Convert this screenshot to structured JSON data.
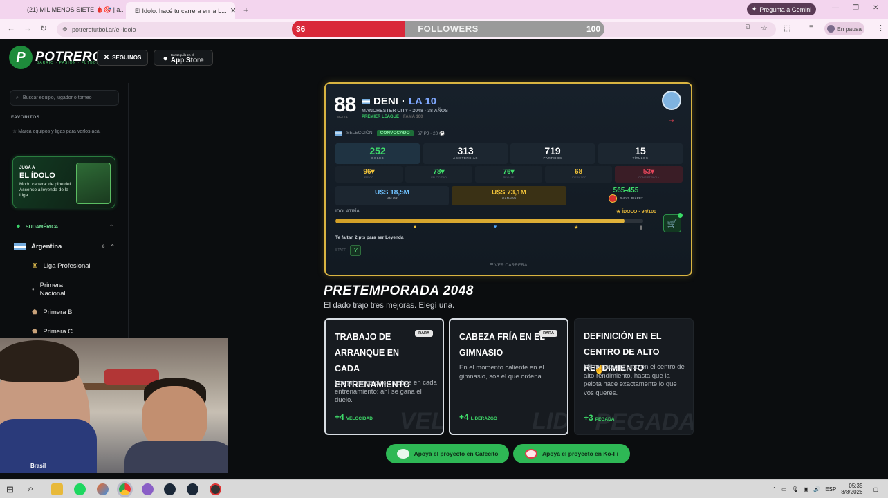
{
  "browser": {
    "tabs": [
      {
        "title": "(21) MIL MENOS SIETE 🩸🎯 | a..."
      },
      {
        "title": "El Ídolo: hacé tu carrera en la L..."
      }
    ],
    "new_tab_label": "+",
    "gemini_label": "Pregunta a Gemini",
    "url": "potrerofutbol.ar/el-idolo",
    "profile_label": "En pausa"
  },
  "overlay": {
    "followers_label": "FOLLOWERS",
    "followers_current": "36",
    "followers_goal": "100",
    "followers_progress": 0.36
  },
  "site": {
    "logo_text": "POTRERO",
    "logo_tag": "BARRIO · PASIÓN · FÚTBOL",
    "follow_label": "SEGUINOS",
    "appstore_small": "Conseguilo en el",
    "appstore_label": "App Store"
  },
  "sidebar": {
    "search_placeholder": "Buscar equipo, jugador o torneo",
    "favoritos_heading": "FAVORITOS",
    "favoritos_text": "Marcá equipos y ligas para verlos acá.",
    "idolo_card": {
      "small": "JUGÁ A",
      "title": "EL ÍDOLO",
      "desc": "Modo carrera: de pibe del Ascenso a leyenda de la Liga"
    },
    "region": "SUDAMÉRICA",
    "country": "Argentina",
    "country_badge": "8",
    "leagues": [
      "Liga Profesional",
      "Primera Nacional",
      "Primera B",
      "Primera C"
    ]
  },
  "webcam_caption": "Brasil",
  "player": {
    "rating": "88",
    "rating_label": "MEDIA",
    "name": "DENI",
    "number": "LA 10",
    "team_line": "MANCHESTER CITY · 2048 · 38 AÑOS",
    "league": "PREMIER LEAGUE",
    "league_extra": "FAMA 100",
    "selection_label": "SELECCIÓN",
    "selection_status": "CONVOCADO",
    "selection_extra": "67 PJ · 20 ⚽",
    "stats": [
      {
        "value": "252",
        "label": "GOLES"
      },
      {
        "value": "313",
        "label": "ASISTENCIAS"
      },
      {
        "value": "719",
        "label": "PARTIDOS"
      },
      {
        "value": "15",
        "label": "TÍTULOS"
      }
    ],
    "attributes": [
      {
        "value": "96▾",
        "label": "FÍSICO",
        "color": "#f0c23a"
      },
      {
        "value": "78▾",
        "label": "VELOCIDAD",
        "color": "#3fdc6a"
      },
      {
        "value": "76▾",
        "label": "REGATE",
        "color": "#3fdc6a"
      },
      {
        "value": "68",
        "label": "LIDERAZGO",
        "color": "#f0c23a"
      },
      {
        "value": "53▾",
        "label": "CONSISTENCIA",
        "color": "#e0455a"
      }
    ],
    "valor": {
      "value": "U$S 18,5M",
      "label": "VALOR"
    },
    "ganado": {
      "value": "U$S 73,1M",
      "label": "GANADO"
    },
    "record": {
      "value": "565-455",
      "label": "0-4 VS JUÁREZ"
    },
    "idolatria_label": "IDOLATRÍA",
    "idolatria_status": "★ ÍDOLO · 94/100",
    "idolatria_progress": 0.94,
    "legend_note": "Te faltan 2 pts para ser Leyenda",
    "staff_label": "STAFF",
    "ver_carrera": "☰ VER CARRERA"
  },
  "pretemporada": {
    "title": "PRETEMPORADA 2048",
    "subtitle": "El dado trajo tres mejoras. Elegí una.",
    "options": [
      {
        "title": "TRABAJO DE ARRANQUE EN CADA ENTRENAMIENTO",
        "rarity": "RARA",
        "desc": "Los primeros cinco metros en cada entrenamiento: ahí se gana el duelo.",
        "bonus": "+4",
        "stat": "VELOCIDAD",
        "watermark": "VEL"
      },
      {
        "title": "CABEZA FRÍA EN EL GIMNASIO",
        "rarity": "RARA",
        "desc": "En el momento caliente en el gimnasio, sos el que ordena.",
        "bonus": "+4",
        "stat": "LIDERAZGO",
        "watermark": "LID"
      },
      {
        "title": "DEFINICIÓN EN EL CENTRO DE ALTO RENDIMIENTO",
        "rarity": "",
        "desc": "Mil remates al arco en el centro de alto rendimiento, hasta que la pelota hace exactamente lo que vos querés.",
        "bonus": "+3",
        "stat": "PEGADA",
        "watermark": "PEGADA"
      }
    ]
  },
  "support": {
    "cafecito": "Apoyá el proyecto en Cafecito",
    "kofi": "Apoyá el proyecto en Ko-Fi"
  },
  "taskbar": {
    "lang": "ESP",
    "time": "05:35",
    "date": "8/8/2026"
  }
}
